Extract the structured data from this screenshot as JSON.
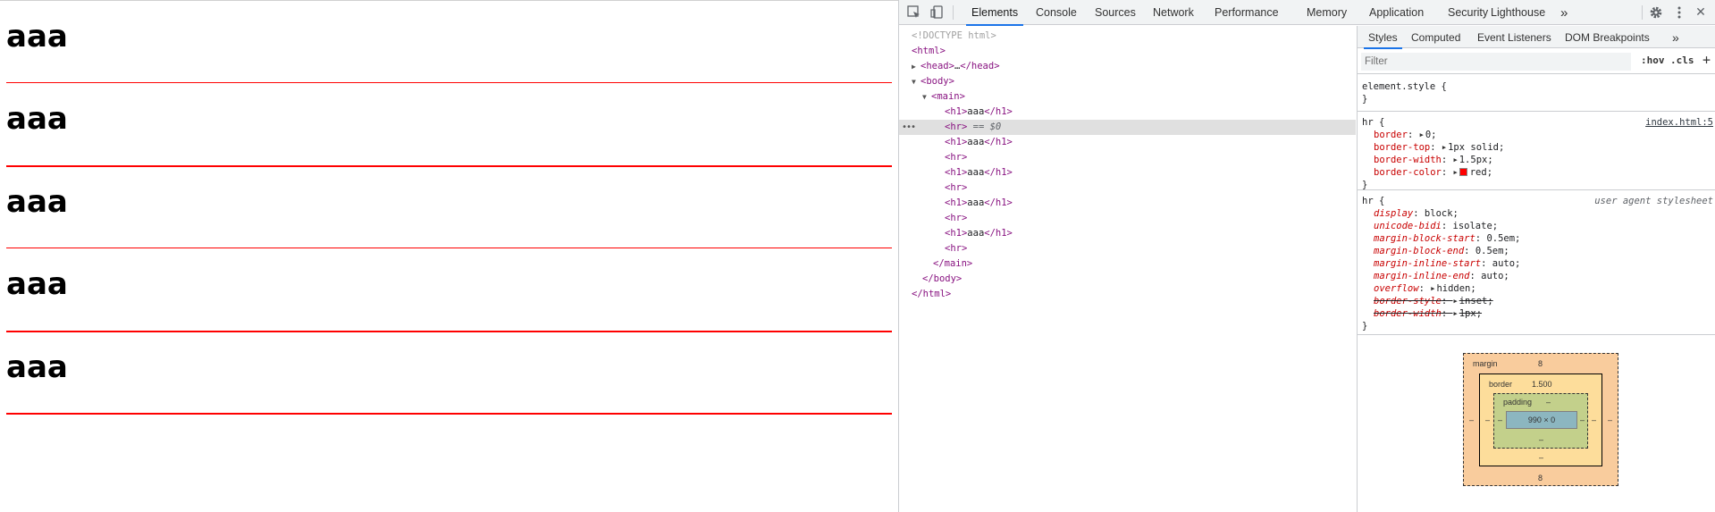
{
  "preview": {
    "headings": [
      "aaa",
      "aaa",
      "aaa",
      "aaa",
      "aaa"
    ],
    "hr_color": "#ff0000"
  },
  "devtools": {
    "tabs": [
      "Elements",
      "Console",
      "Sources",
      "Network",
      "Performance",
      "Memory",
      "Application",
      "Security",
      "Lighthouse"
    ],
    "selected_tab": "Elements",
    "more_tabs": "»",
    "toolbar_icons": [
      "inspect-element-icon",
      "device-toolbar-icon",
      "gear-icon",
      "kebab-menu-icon",
      "close-icon"
    ],
    "close": "✕"
  },
  "dom_tree": {
    "doctype": "<!DOCTYPE html>",
    "html_open": "<html>",
    "head_open": "<head>",
    "head_ellipsis": "…",
    "head_close": "</head>",
    "body_open": "<body>",
    "main_open": "<main>",
    "h1_open": "<h1>",
    "h1_text": "aaa",
    "h1_close": "</h1>",
    "hr": "<hr>",
    "selected_eq": "==",
    "selected_var": "$0",
    "main_close": "</main>",
    "body_close": "</body>",
    "html_close": "</html>",
    "dots": "•••"
  },
  "styles": {
    "tabs": [
      "Styles",
      "Computed",
      "Event Listeners",
      "DOM Breakpoints"
    ],
    "selected_tab": "Styles",
    "more_tabs": "»",
    "filter_placeholder": "Filter",
    "hov": ":hov",
    "cls": ".cls",
    "add": "+",
    "element_style": {
      "selector": "element.style {",
      "close": "}"
    },
    "author_rule": {
      "selector": "hr",
      "open": "{",
      "source": "index.html:5",
      "declarations": [
        {
          "prop": "border",
          "value": "0;",
          "arrow": true
        },
        {
          "prop": "border-top",
          "value": "1px solid;",
          "arrow": true
        },
        {
          "prop": "border-width",
          "value": "1.5px;",
          "arrow": true
        },
        {
          "prop": "border-color",
          "value": "red;",
          "arrow": true,
          "swatch": "#ff0000"
        }
      ],
      "close": "}"
    },
    "ua_rule": {
      "selector": "hr",
      "open": "{",
      "source": "user agent stylesheet",
      "declarations": [
        {
          "prop": "display",
          "value": "block;"
        },
        {
          "prop": "unicode-bidi",
          "value": "isolate;"
        },
        {
          "prop": "margin-block-start",
          "value": "0.5em;"
        },
        {
          "prop": "margin-block-end",
          "value": "0.5em;"
        },
        {
          "prop": "margin-inline-start",
          "value": "auto;"
        },
        {
          "prop": "margin-inline-end",
          "value": "auto;"
        },
        {
          "prop": "overflow",
          "value": "hidden;",
          "arrow": true
        },
        {
          "prop": "border-style",
          "value": "inset;",
          "arrow": true,
          "overridden": true
        },
        {
          "prop": "border-width",
          "value": "1px;",
          "arrow": true,
          "overridden": true
        }
      ],
      "close": "}"
    }
  },
  "box_model": {
    "margin_label": "margin",
    "margin_top": "8",
    "margin_bottom": "8",
    "margin_left": "–",
    "margin_right": "–",
    "border_label": "border",
    "border_top": "1.500",
    "border_bottom": "–",
    "border_left": "–",
    "border_right": "–",
    "padding_label": "padding",
    "padding_top": "–",
    "padding_bottom": "–",
    "padding_left": "–",
    "padding_right": "–",
    "content": "990 × 0",
    "colors": {
      "margin": "#f9cc9d",
      "border": "#fddd9b",
      "padding": "#c3d08b",
      "content": "#8cb6c0"
    }
  }
}
